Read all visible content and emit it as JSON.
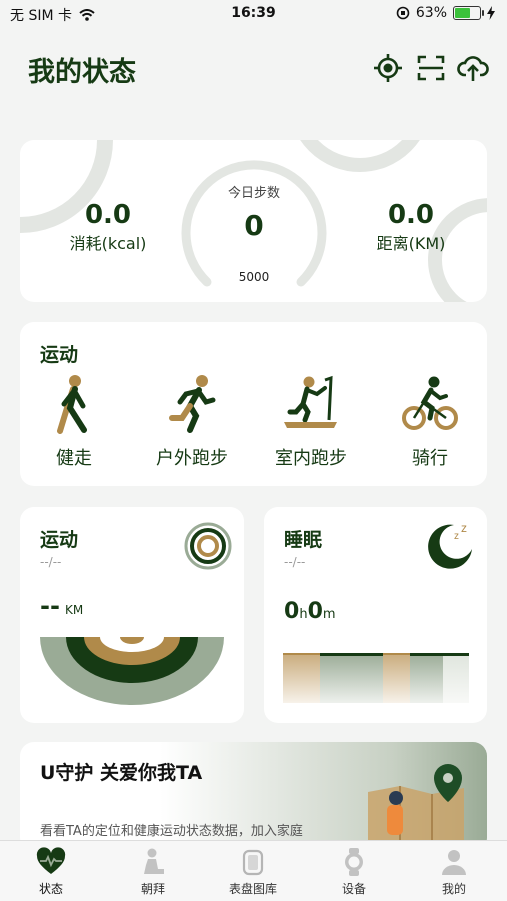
{
  "status_bar": {
    "carrier": "无 SIM 卡",
    "time": "16:39",
    "battery": "63%",
    "battery_level": 0.63
  },
  "header": {
    "title": "我的状态"
  },
  "summary": {
    "calories_value": "0.0",
    "calories_label": "消耗(kcal)",
    "steps_title": "今日步数",
    "steps_value": "0",
    "steps_goal": "5000",
    "distance_value": "0.0",
    "distance_label": "距离(KM)"
  },
  "sports": {
    "title": "运动",
    "items": [
      {
        "label": "健走",
        "icon": "walking-icon"
      },
      {
        "label": "户外跑步",
        "icon": "running-icon"
      },
      {
        "label": "室内跑步",
        "icon": "treadmill-icon"
      },
      {
        "label": "骑行",
        "icon": "cycling-icon"
      }
    ]
  },
  "exercise_card": {
    "title": "运动",
    "date": "--/--",
    "value": "--",
    "unit": "KM"
  },
  "sleep_card": {
    "title": "睡眠",
    "date": "--/--",
    "hours": "0",
    "h_unit": "h",
    "minutes": "0",
    "m_unit": "m"
  },
  "promo": {
    "title": "U守护 关爱你我TA",
    "desc": "看看TA的定位和健康运动状态数据，加入家庭"
  },
  "tabs": [
    {
      "label": "状态",
      "icon": "heart-pulse-icon"
    },
    {
      "label": "朝拜",
      "icon": "prayer-icon"
    },
    {
      "label": "表盘图库",
      "icon": "watch-face-icon"
    },
    {
      "label": "设备",
      "icon": "watch-icon"
    },
    {
      "label": "我的",
      "icon": "person-icon"
    }
  ],
  "colors": {
    "primary": "#163a14",
    "accent": "#b08a4a",
    "sage": "#9aab96",
    "background": "#f3f4f3"
  }
}
